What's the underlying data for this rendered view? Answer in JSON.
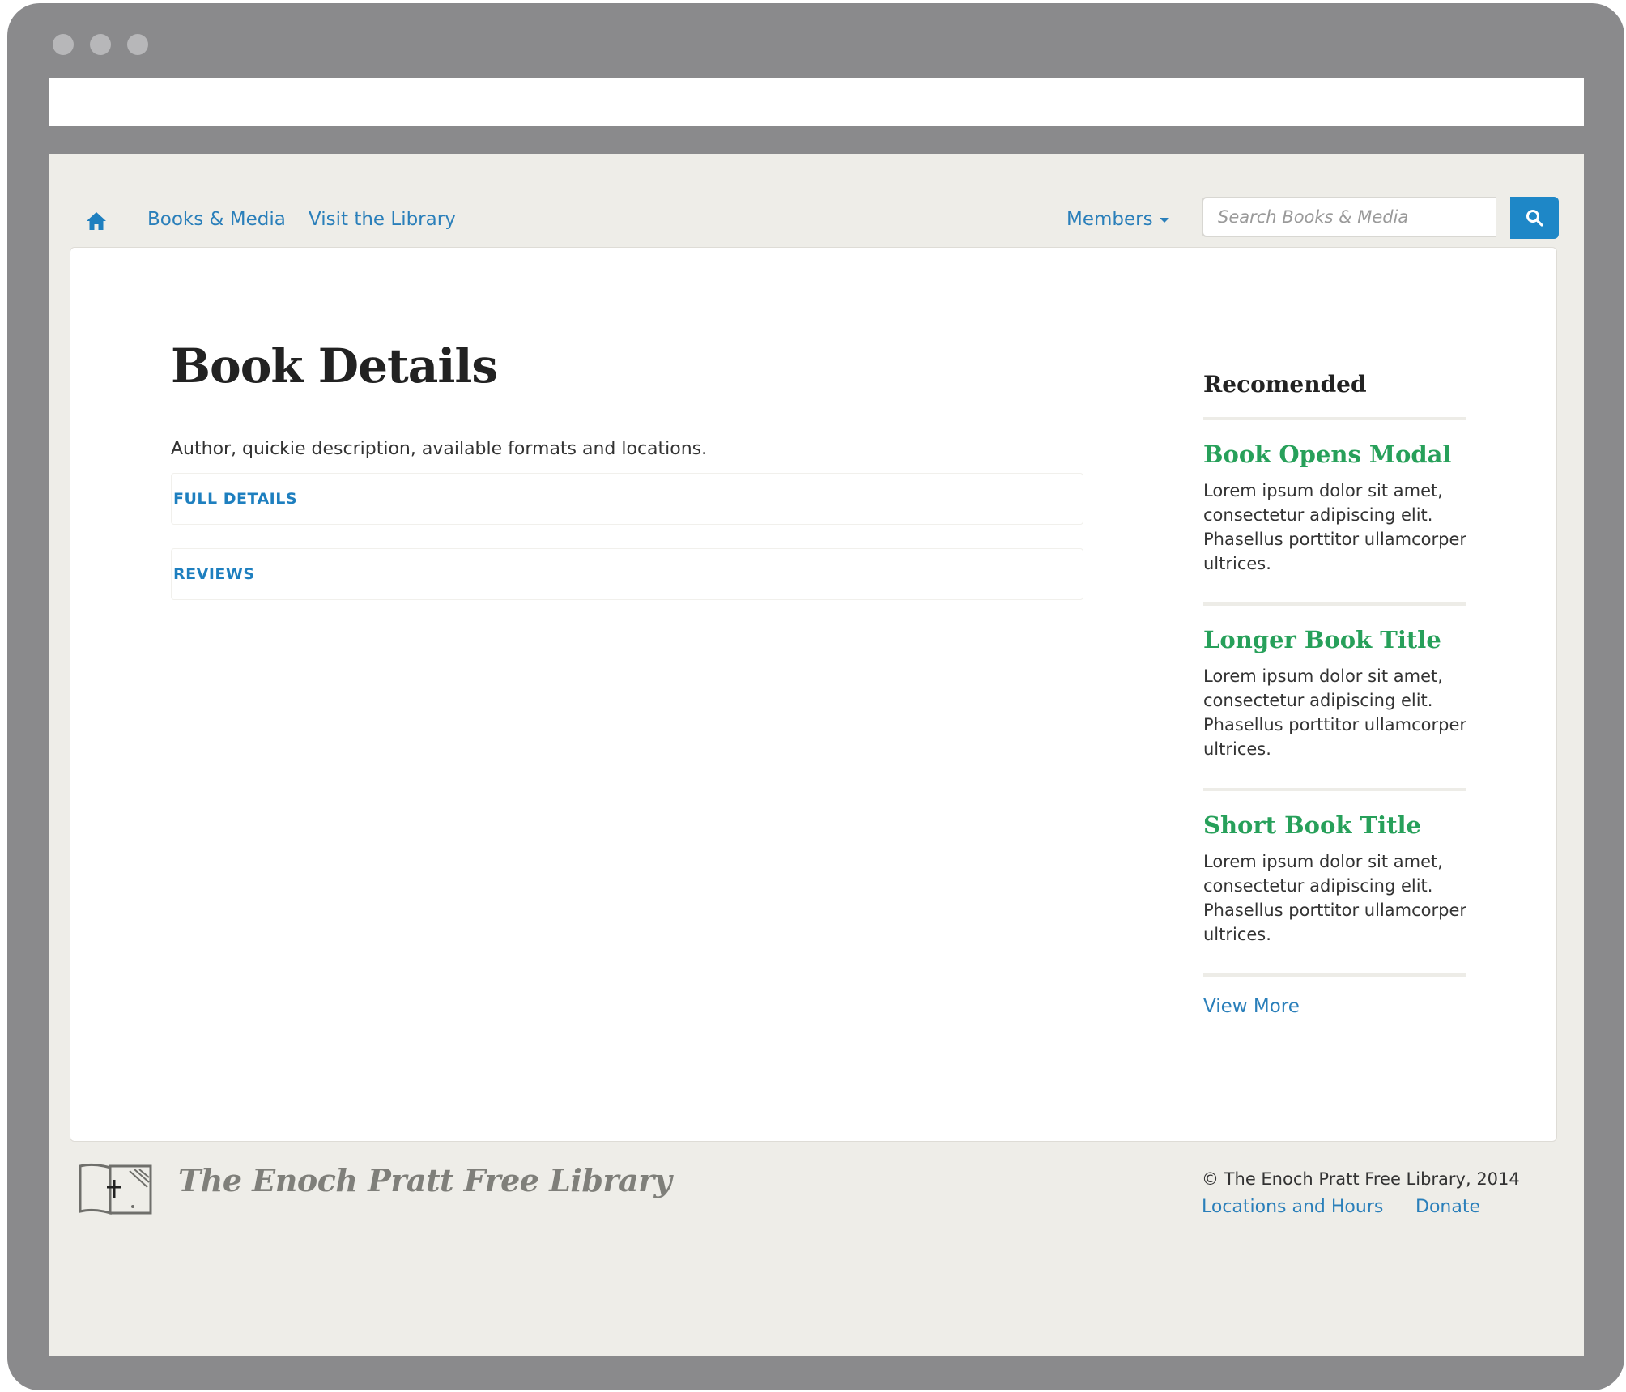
{
  "nav": {
    "home_icon": "home-icon",
    "books_media": "Books & Media",
    "visit_library": "Visit the Library",
    "members": "Members",
    "search_placeholder": "Search Books & Media",
    "search_icon": "search-icon"
  },
  "main": {
    "title": "Book Details",
    "description": "Author, quickie description, available formats and locations.",
    "accordion": [
      {
        "label": "FULL DETAILS"
      },
      {
        "label": "REVIEWS"
      }
    ]
  },
  "sidebar": {
    "heading": "Recomended",
    "items": [
      {
        "title": "Book Opens Modal",
        "body": "Lorem ipsum dolor sit amet, consectetur adipiscing elit. Phasellus porttitor ullamcorper ultrices."
      },
      {
        "title": "Longer Book Title",
        "body": "Lorem ipsum dolor sit amet, consectetur adipiscing elit. Phasellus porttitor ullamcorper ultrices."
      },
      {
        "title": "Short Book Title",
        "body": "Lorem ipsum dolor sit amet, consectetur adipiscing elit. Phasellus porttitor ullamcorper ultrices."
      }
    ],
    "view_more": "View More"
  },
  "footer": {
    "brand": "The Enoch Pratt Free Library",
    "logo_icon": "library-logo-icon",
    "copyright": "© The Enoch Pratt Free Library, 2014",
    "locations": "Locations and Hours",
    "donate": "Donate"
  },
  "colors": {
    "link": "#2a7fba",
    "accent_green": "#27a05a",
    "search_button": "#1e87c7",
    "page_background": "#eeede8",
    "browser_chrome": "#8a8a8c"
  }
}
